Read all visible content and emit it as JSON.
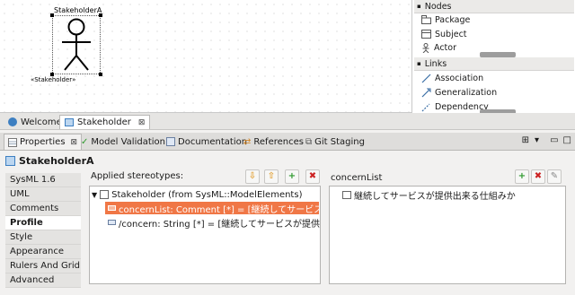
{
  "diagram": {
    "actor_name": "StakeholderA",
    "stereotype_label": "«Stakeholder»"
  },
  "palette": {
    "nodes_header": "Nodes",
    "node_items": [
      "Package",
      "Subject",
      "Actor"
    ],
    "links_header": "Links",
    "link_items": [
      "Association",
      "Generalization",
      "Dependency"
    ]
  },
  "editor_tabs": [
    {
      "label": "Welcome",
      "icon": "welcome-icon",
      "active": false
    },
    {
      "label": "Stakeholder",
      "icon": "diagram-icon",
      "active": true,
      "close": "⊠"
    }
  ],
  "view_tabs": [
    {
      "label": "Properties",
      "icon": "properties-icon",
      "active": true,
      "close": "⊠"
    },
    {
      "label": "Model Validation",
      "icon": "checkmark-icon"
    },
    {
      "label": "Documentation",
      "icon": "documentation-icon"
    },
    {
      "label": "References",
      "icon": "references-icon"
    },
    {
      "label": "Git Staging",
      "icon": "git-icon"
    }
  ],
  "properties": {
    "title": "StakeholderA",
    "categories": [
      "SysML 1.6",
      "UML",
      "Comments",
      "Profile",
      "Style",
      "Appearance",
      "Rulers And Grid",
      "Advanced"
    ],
    "active_category": "Profile",
    "applied_stereotypes_label": "Applied stereotypes:",
    "stereotype_tree": {
      "root": "Stakeholder   (from SysML::ModelElements)",
      "children": [
        "concernList: Comment [*] = [継続してサービスが...]",
        "/concern: String [*] = [継続してサービスが提供出来る仕"
      ]
    },
    "concern_list": {
      "label": "concernList",
      "items": [
        "継続してサービスが提供出来る仕組みか"
      ]
    }
  },
  "colors": {
    "selection": "#f07746",
    "add_button": "#2e9a2e",
    "remove_button": "#cc2222",
    "move_button": "#e3a33a"
  }
}
